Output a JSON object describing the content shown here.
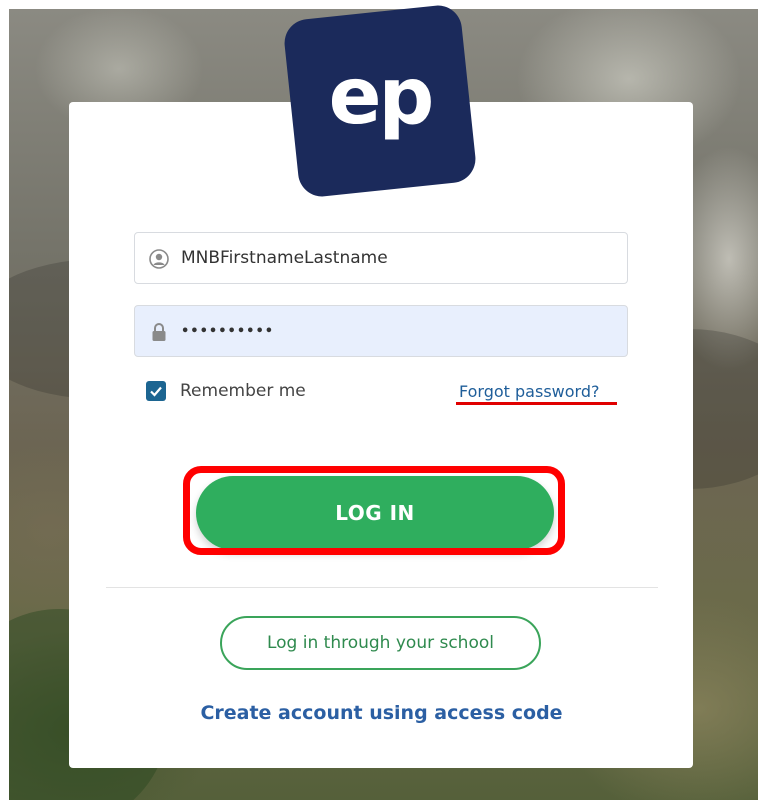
{
  "logo": {
    "text": "ep",
    "bg_color": "#1b2a5b"
  },
  "login_form": {
    "username": {
      "value": "MNBFirstnameLastname",
      "icon": "user-icon"
    },
    "password": {
      "value": "••••••••••",
      "icon": "lock-icon",
      "bg_color": "#e8effd"
    },
    "remember_me": {
      "label": "Remember me",
      "checked": true,
      "color": "#1c6591"
    },
    "forgot_password": "Forgot password?",
    "login_button": {
      "label": "LOG IN",
      "color": "#2fae5e"
    },
    "school_button": "Log in through your school",
    "create_account": "Create account using access code"
  },
  "annotations": {
    "highlight_color": "#ff0000"
  }
}
